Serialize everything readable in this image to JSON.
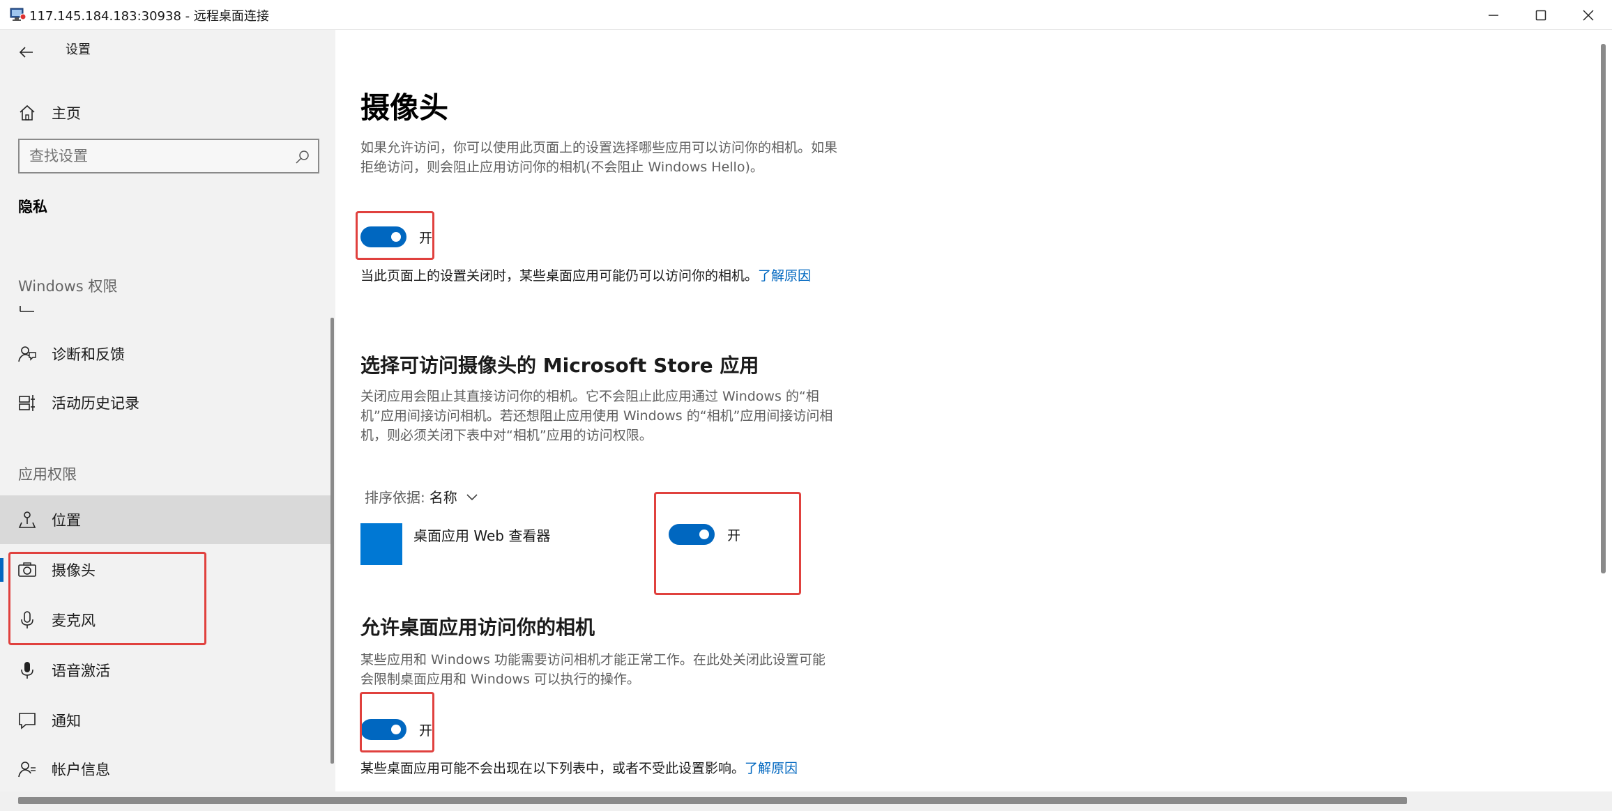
{
  "window": {
    "title": "117.145.184.183:30938 - 远程桌面连接"
  },
  "sidebar": {
    "settings_label": "设置",
    "home_label": "主页",
    "search_placeholder": "查找设置",
    "section_title": "隐私",
    "windows_permissions": "Windows 权限",
    "items_top": [
      {
        "label": "诊断和反馈",
        "icon": "feedback-icon"
      },
      {
        "label": "活动历史记录",
        "icon": "timeline-icon"
      }
    ],
    "app_permissions": "应用权限",
    "items_bottom": [
      {
        "label": "位置",
        "icon": "location-icon"
      },
      {
        "label": "摄像头",
        "icon": "camera-icon"
      },
      {
        "label": "麦克风",
        "icon": "microphone-icon"
      },
      {
        "label": "语音激活",
        "icon": "voice-icon"
      },
      {
        "label": "通知",
        "icon": "notification-icon"
      },
      {
        "label": "帐户信息",
        "icon": "account-icon"
      }
    ]
  },
  "main": {
    "title": "摄像头",
    "intro": "如果允许访问，你可以使用此页面上的设置选择哪些应用可以访问你的相机。如果拒绝访问，则会阻止应用访问你的相机(不会阻止 Windows Hello)。",
    "toggle1_label": "开",
    "note1": "当此页面上的设置关闭时，某些桌面应用可能仍可以访问你的相机。",
    "note1_link": "了解原因",
    "store_heading": "选择可访问摄像头的 Microsoft Store 应用",
    "store_desc": "关闭应用会阻止其直接访问你的相机。它不会阻止此应用通过 Windows 的“相机”应用间接访问相机。若还想阻止应用使用 Windows 的“相机”应用间接访问相机，则必须关闭下表中对“相机”应用的访问权限。",
    "sort_label": "排序依据:",
    "sort_value": "名称",
    "app_name": "桌面应用 Web 查看器",
    "toggle2_label": "开",
    "desktop_heading": "允许桌面应用访问你的相机",
    "desktop_desc": "某些应用和 Windows 功能需要访问相机才能正常工作。在此处关闭此设置可能会限制桌面应用和 Windows 可以执行的操作。",
    "toggle3_label": "开",
    "note2": "某些桌面应用可能不会出现在以下列表中，或者不受此设置影响。",
    "note2_link": "了解原因"
  },
  "colors": {
    "accent": "#0067c0",
    "annotation": "#e0413e"
  }
}
